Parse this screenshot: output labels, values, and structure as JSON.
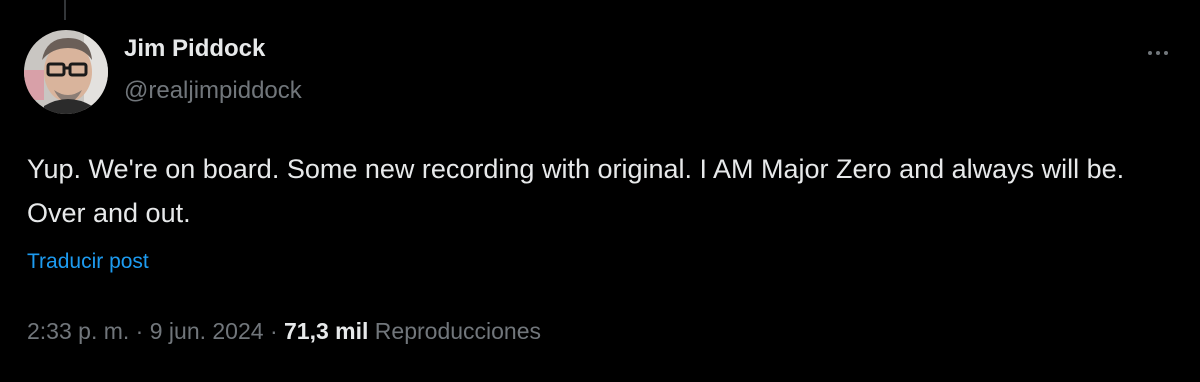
{
  "author": {
    "name": "Jim Piddock",
    "handle": "@realjimpiddock"
  },
  "post": {
    "text": "Yup. We're on board. Some new recording with original. I AM Major Zero and always will be. Over and out.",
    "translate_label": "Traducir post",
    "time": "2:33 p. m.",
    "separator": "·",
    "date": "9 jun. 2024",
    "views_count": "71,3 mil",
    "views_label": "Reproducciones"
  },
  "icons": {
    "more": "more-horizontal-icon"
  },
  "colors": {
    "background": "#000000",
    "primary_text": "#e7e9ea",
    "secondary_text": "#71767b",
    "link": "#1d9bf0"
  }
}
